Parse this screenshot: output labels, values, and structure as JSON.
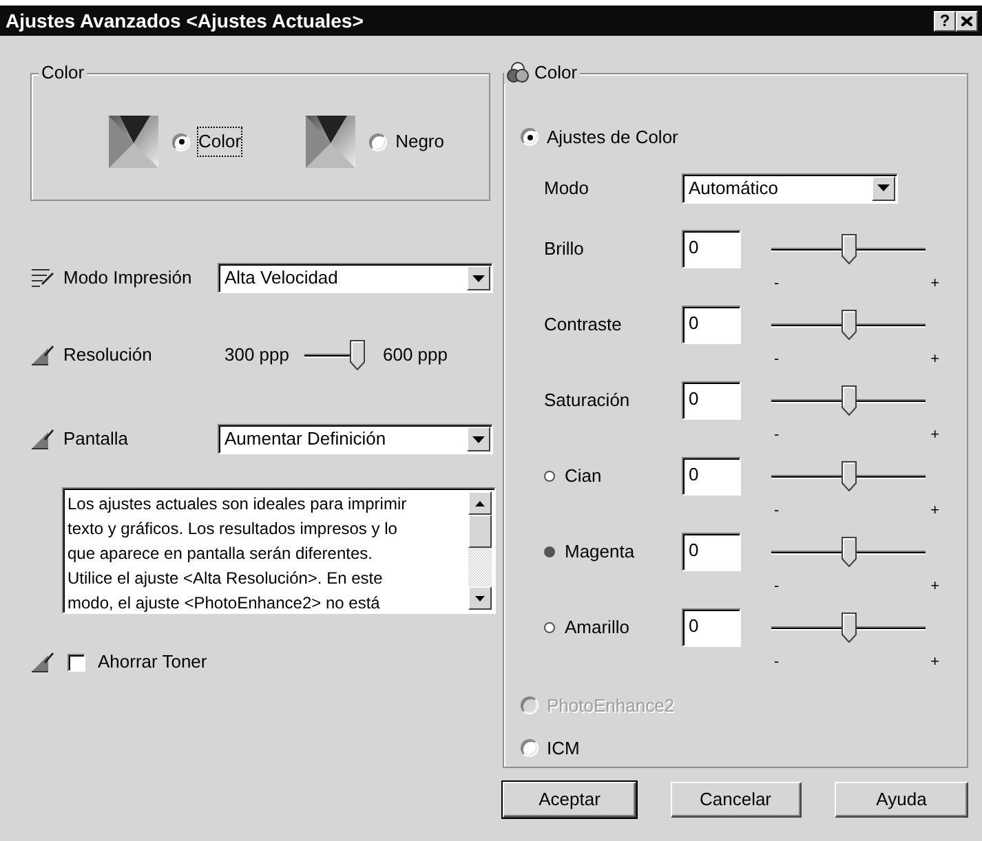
{
  "window": {
    "title": "Ajustes Avanzados <Ajustes Actuales>",
    "help_button": "?"
  },
  "print_color": {
    "title": "Color",
    "options": [
      {
        "label": "Color",
        "selected": true,
        "focused": true
      },
      {
        "label": "Negro",
        "selected": false,
        "focused": false
      }
    ]
  },
  "settings": [
    {
      "kind": "select",
      "label": "Modo Impresión",
      "value": "Alta Velocidad"
    },
    {
      "kind": "slider",
      "label": "Resolución",
      "min_label": "300 ppp",
      "max_label": "600 ppp",
      "level": 1
    },
    {
      "kind": "select",
      "label": "Pantalla",
      "value": "Aumentar Definición"
    }
  ],
  "description": {
    "lines": [
      "Los ajustes actuales son ideales para imprimir",
      "texto y gráficos. Los resultados impresos y lo",
      "que aparece en pantalla serán diferentes.",
      "Utilice el ajuste <Alta Resolución>. En este",
      "modo, el ajuste <PhotoEnhance2> no está"
    ]
  },
  "toner": {
    "label": "Ahorrar Toner",
    "checked": false
  },
  "color_panel": {
    "title": "Color",
    "color_settings": {
      "label": "Ajustes de Color",
      "selected": true,
      "disabled": false
    },
    "mode": {
      "label": "Modo",
      "value": "Automático"
    },
    "adjustments": [
      {
        "kind": "plain",
        "label": "Brillo",
        "value": "0",
        "level": 0.5,
        "min_label": "-",
        "max_label": "+"
      },
      {
        "kind": "plain",
        "label": "Contraste",
        "value": "0",
        "level": 0.5,
        "min_label": "-",
        "max_label": "+"
      },
      {
        "kind": "plain",
        "label": "Saturación",
        "value": "0",
        "level": 0.5,
        "min_label": "-",
        "max_label": "+"
      },
      {
        "kind": "channel",
        "label": "Cian",
        "selected": false,
        "value": "0",
        "level": 0.5,
        "min_label": "-",
        "max_label": "+"
      },
      {
        "kind": "channel",
        "label": "Magenta",
        "selected": true,
        "value": "0",
        "level": 0.5,
        "min_label": "-",
        "max_label": "+"
      },
      {
        "kind": "channel",
        "label": "Amarillo",
        "selected": false,
        "value": "0",
        "level": 0.5,
        "min_label": "-",
        "max_label": "+"
      }
    ],
    "other_modes": [
      {
        "label": "PhotoEnhance2",
        "selected": false,
        "disabled": true
      },
      {
        "label": "ICM",
        "selected": false,
        "disabled": false
      }
    ]
  },
  "buttons": [
    {
      "label": "Aceptar",
      "default": true
    },
    {
      "label": "Cancelar",
      "default": false
    },
    {
      "label": "Ayuda",
      "default": false
    }
  ]
}
